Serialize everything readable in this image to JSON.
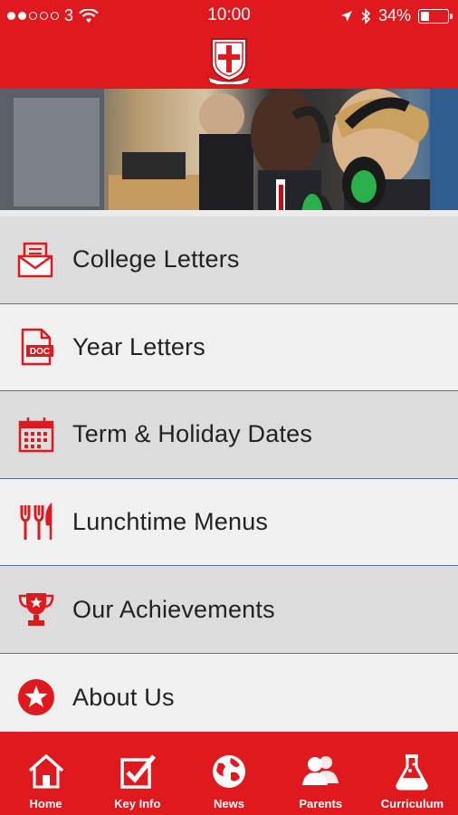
{
  "status_bar": {
    "carrier": "3",
    "time": "10:00",
    "battery": "34%",
    "battery_fraction": 0.34,
    "signal_dots_filled": 2,
    "signal_dots_total": 5
  },
  "colors": {
    "brand_red": "#e0191f",
    "row_shade": "#dcdcdc",
    "row_light": "#f0f0f0",
    "divider": "#5a6f9a"
  },
  "menu": {
    "items": [
      {
        "label": "College Letters",
        "icon": "envelope-letter-icon"
      },
      {
        "label": "Year Letters",
        "icon": "doc-file-icon"
      },
      {
        "label": "Term & Holiday Dates",
        "icon": "calendar-icon"
      },
      {
        "label": "Lunchtime Menus",
        "icon": "fork-knife-icon"
      },
      {
        "label": "Our Achievements",
        "icon": "trophy-icon"
      },
      {
        "label": "About Us",
        "icon": "star-circle-icon"
      }
    ]
  },
  "tabbar": {
    "tabs": [
      {
        "label": "Home",
        "icon": "home-icon"
      },
      {
        "label": "Key Info",
        "icon": "checkbox-icon",
        "active": true
      },
      {
        "label": "News",
        "icon": "globe-icon"
      },
      {
        "label": "Parents",
        "icon": "people-icon"
      },
      {
        "label": "Curriculum",
        "icon": "flask-icon"
      }
    ]
  }
}
